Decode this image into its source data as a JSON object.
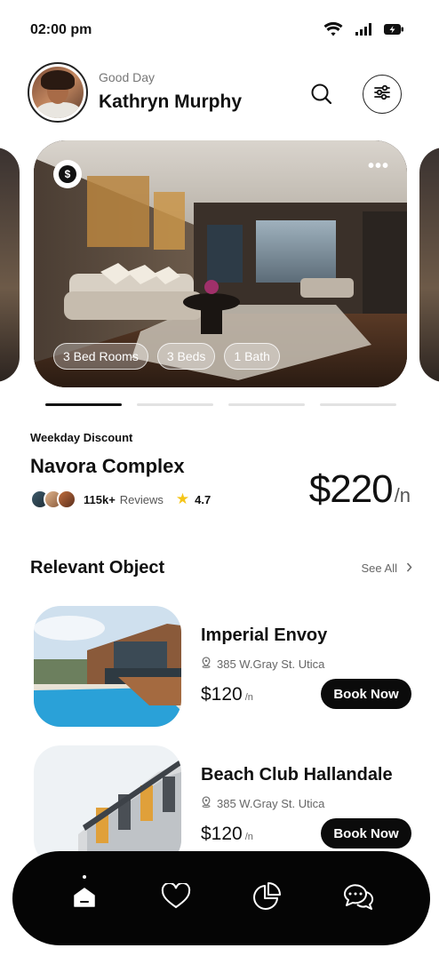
{
  "status_bar": {
    "time": "02:00 pm",
    "icons": [
      "wifi-icon",
      "signal-icon",
      "battery-charging-icon"
    ]
  },
  "header": {
    "greeting": "Good Day",
    "user_name": "Kathryn Murphy",
    "icons": [
      "search-icon",
      "filter-icon"
    ]
  },
  "featured": {
    "chips": [
      "3 Bed Rooms",
      "3 Beds",
      "1 Bath"
    ],
    "badge_icon": "dollar-icon",
    "menu_icon": "more-icon",
    "tag": "Weekday Discount",
    "name": "Navora Complex",
    "review_count": "115k+",
    "review_label": "Reviews",
    "rating": "4.7",
    "price": "$220",
    "price_unit": "/n",
    "active_slide": 1,
    "slide_count": 4
  },
  "relevant": {
    "title": "Relevant Object",
    "see_all": "See All",
    "items": [
      {
        "title": "Imperial Envoy",
        "address": "385 W.Gray St. Utica",
        "price": "$120",
        "unit": "/n",
        "button": "Book Now"
      },
      {
        "title": "Beach Club Hallandale",
        "address": "385 W.Gray St. Utica",
        "price": "$120",
        "unit": "/n",
        "button": "Book Now"
      }
    ]
  },
  "bottom_nav": {
    "items": [
      "home-icon",
      "heart-icon",
      "pie-chart-icon",
      "chat-icon"
    ],
    "active": "home-icon"
  },
  "colors": {
    "primary": "#0b0b0b",
    "background": "#ffffff",
    "star": "#f5c518",
    "muted_text": "#666666"
  }
}
